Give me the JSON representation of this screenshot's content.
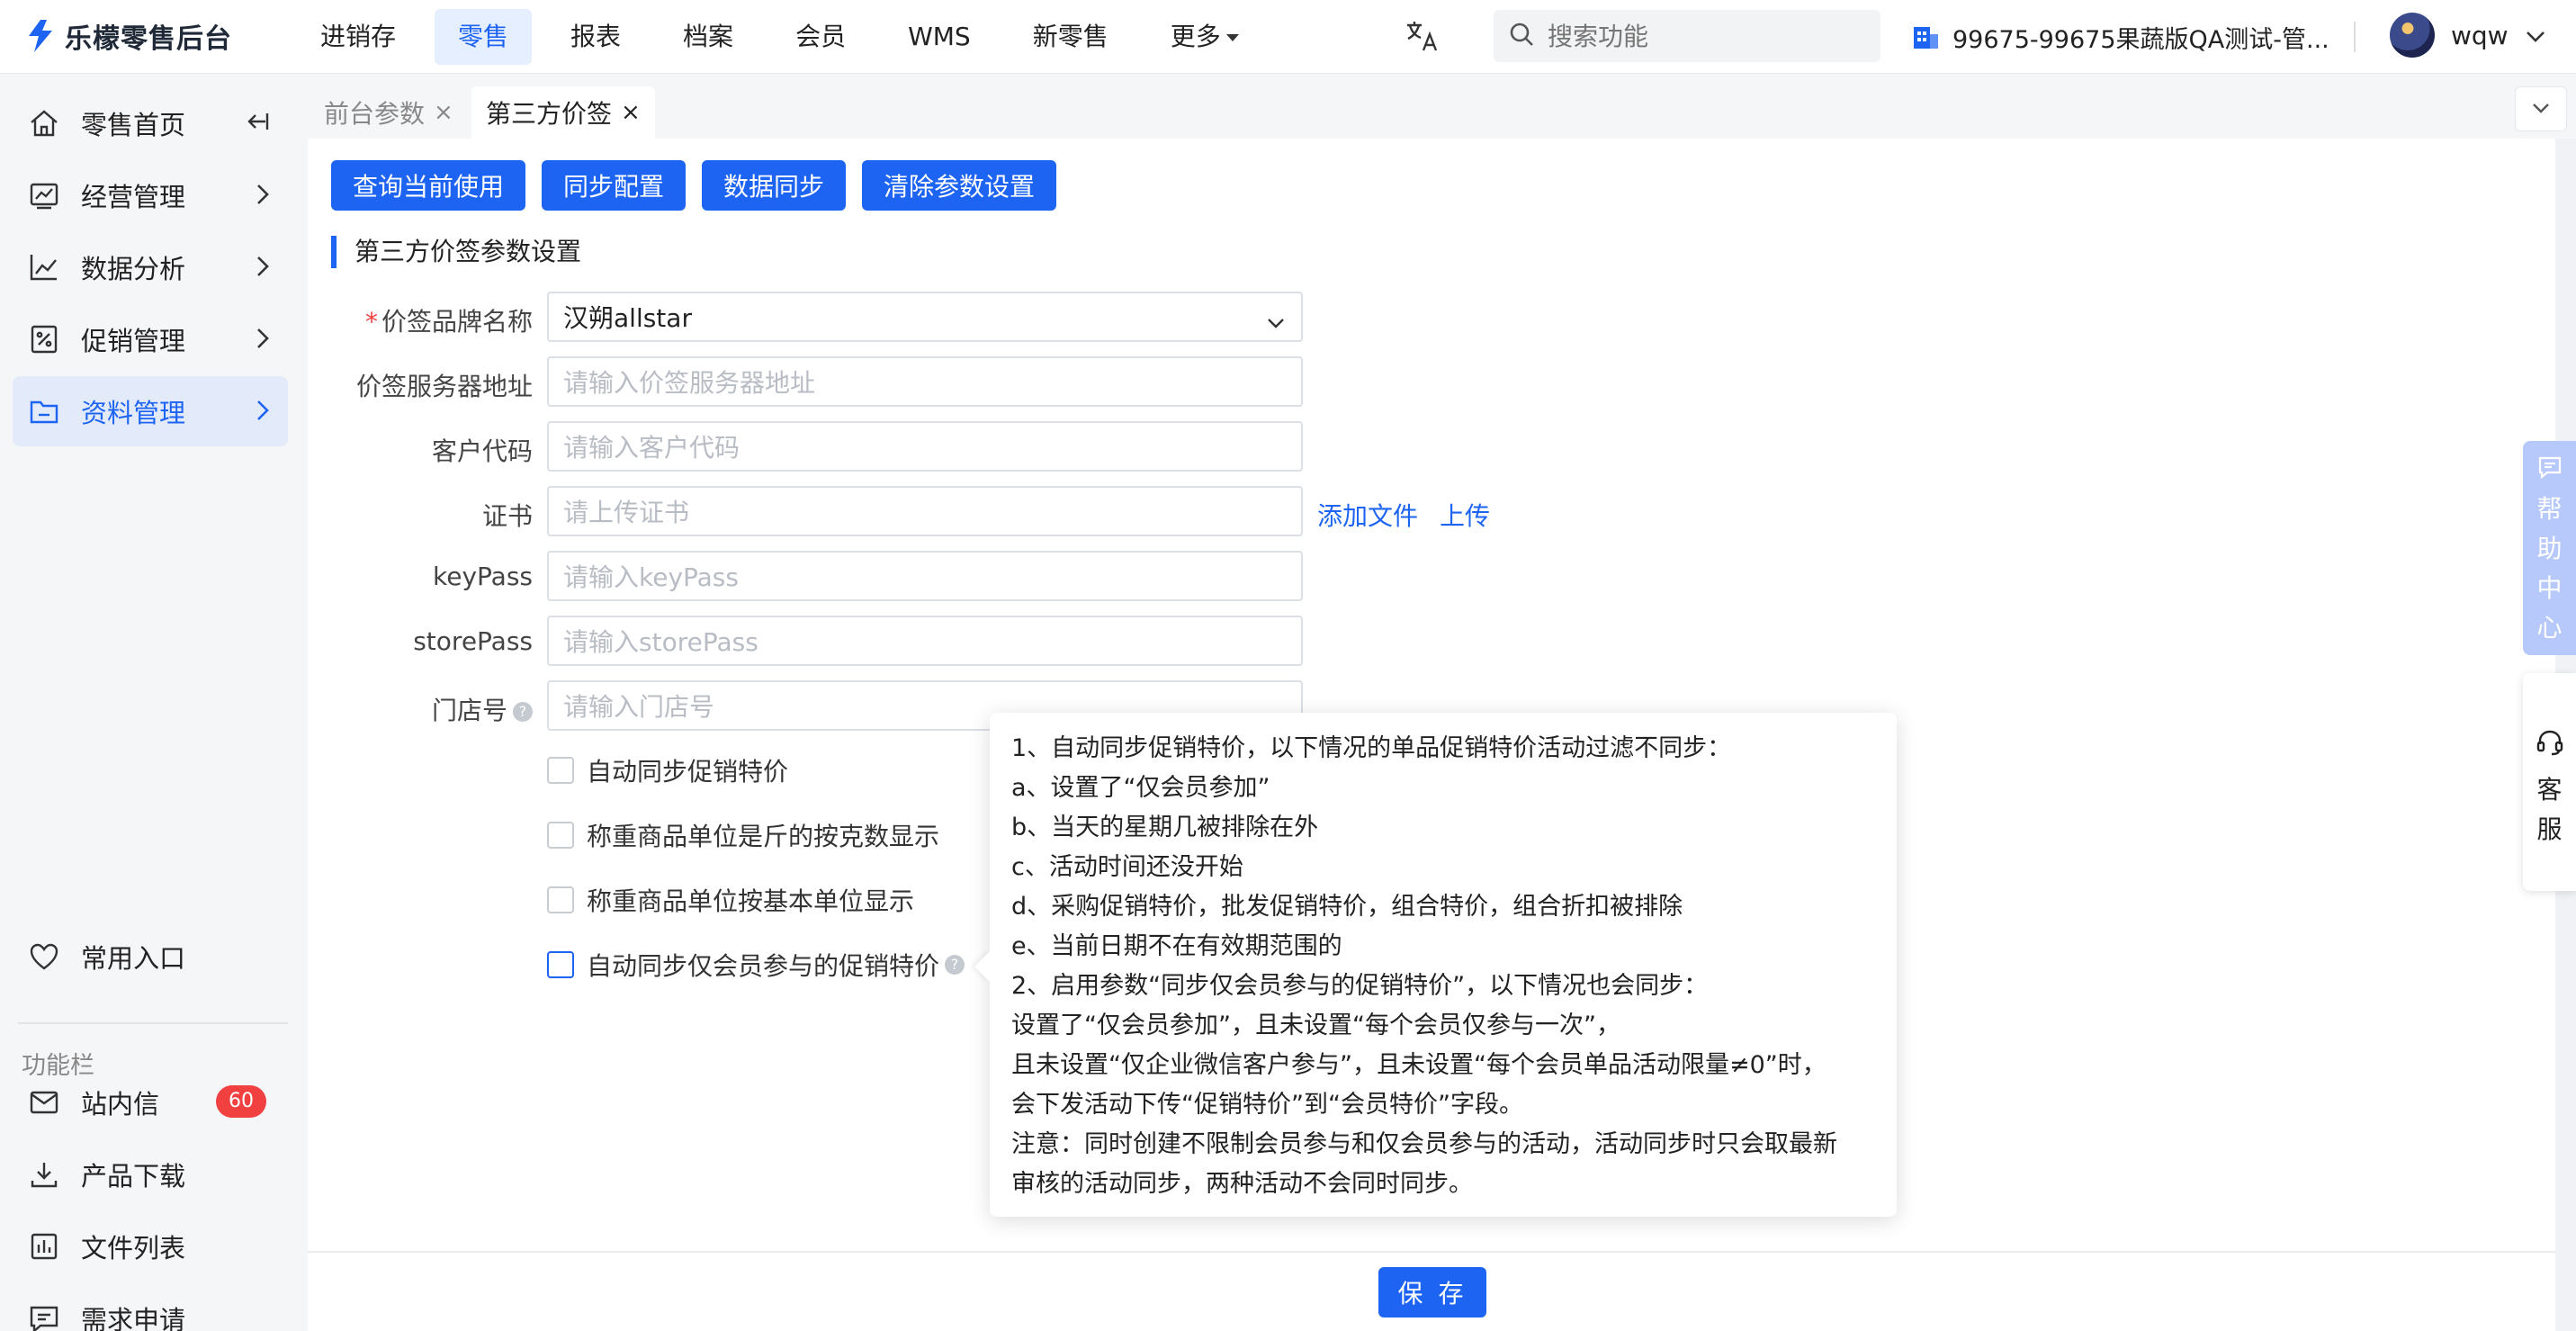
{
  "app": {
    "logo_text": "乐檬零售后台"
  },
  "topnav": {
    "items": [
      "进销存",
      "零售",
      "报表",
      "档案",
      "会员",
      "WMS",
      "新零售",
      "更多"
    ],
    "active_index": 1
  },
  "search": {
    "placeholder": "搜索功能"
  },
  "store": {
    "name": "99675-99675果蔬版QA测试-管..."
  },
  "user": {
    "name": "wqw"
  },
  "sidebar": {
    "items": [
      {
        "label": "零售首页",
        "icon": "home-icon"
      },
      {
        "label": "经营管理",
        "icon": "dashboard-icon"
      },
      {
        "label": "数据分析",
        "icon": "line-chart-icon"
      },
      {
        "label": "促销管理",
        "icon": "promotion-icon"
      },
      {
        "label": "资料管理",
        "icon": "folder-icon"
      }
    ],
    "active_index": 4,
    "favorites_label": "常用入口",
    "group_label": "功能栏",
    "tools": [
      {
        "label": "站内信",
        "icon": "mail-icon",
        "badge": "60"
      },
      {
        "label": "产品下载",
        "icon": "download-icon"
      },
      {
        "label": "文件列表",
        "icon": "file-list-icon"
      },
      {
        "label": "需求申请",
        "icon": "request-icon"
      }
    ]
  },
  "tabs": [
    {
      "label": "前台参数",
      "close": "×"
    },
    {
      "label": "第三方价签",
      "close": "×"
    }
  ],
  "toolbar": {
    "buttons": [
      "查询当前使用",
      "同步配置",
      "数据同步",
      "清除参数设置"
    ]
  },
  "section": {
    "title": "第三方价签参数设置"
  },
  "form": {
    "required_mark": "*",
    "brand": {
      "label": "价签品牌名称",
      "value": "汉朔allstar"
    },
    "server": {
      "label": "价签服务器地址",
      "placeholder": "请输入价签服务器地址"
    },
    "customer": {
      "label": "客户代码",
      "placeholder": "请输入客户代码"
    },
    "cert": {
      "label": "证书",
      "placeholder": "请上传证书",
      "add_file": "添加文件",
      "upload": "上传"
    },
    "keypass": {
      "label": "keyPass",
      "placeholder": "请输入keyPass"
    },
    "storepass": {
      "label": "storePass",
      "placeholder": "请输入storePass"
    },
    "storeno": {
      "label": "门店号",
      "placeholder": "请输入门店号"
    },
    "checks": [
      "自动同步促销特价",
      "称重商品单位是斤的按克数显示",
      "称重商品单位按基本单位显示",
      "自动同步仅会员参与的促销特价"
    ]
  },
  "tooltip": {
    "lines": [
      "1、自动同步促销特价，以下情况的单品促销特价活动过滤不同步：",
      "a、设置了“仅会员参加”",
      "b、当天的星期几被排除在外",
      "c、活动时间还没开始",
      "d、采购促销特价，批发促销特价，组合特价，组合折扣被排除",
      "e、当前日期不在有效期范围的",
      "2、启用参数“同步仅会员参与的促销特价”，以下情况也会同步：",
      "设置了“仅会员参加”，且未设置“每个会员仅参与一次”，",
      "且未设置“仅企业微信客户参与”，且未设置“每个会员单品活动限量≠0”时，",
      "会下发活动下传“促销特价”到“会员特价”字段。",
      "注意：同时创建不限制会员参与和仅会员参与的活动，活动同步时只会取最新",
      "审核的活动同步，两种活动不会同时同步。"
    ]
  },
  "footer": {
    "save_label": "保 存"
  },
  "float": {
    "help": [
      "帮",
      "助",
      "中",
      "心"
    ],
    "service": [
      "客",
      "服"
    ]
  },
  "colors": {
    "primary": "#1d64f2",
    "danger": "#f04040"
  }
}
